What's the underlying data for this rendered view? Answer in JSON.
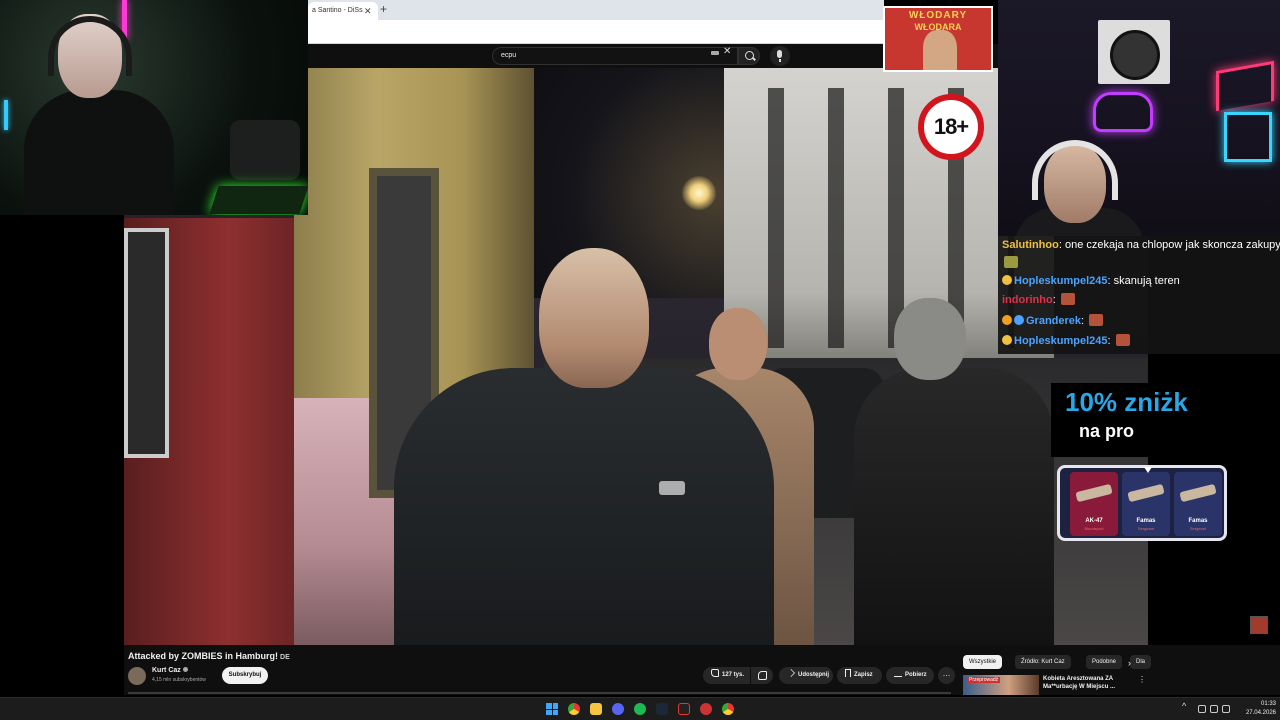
{
  "browser": {
    "tab_title": "a Santino - DiSs",
    "search_query": "ecpu"
  },
  "banner": {
    "line1": "WŁODARY",
    "line2": "WŁODARA"
  },
  "overlay": {
    "age_rating": "18+"
  },
  "chat": {
    "messages": [
      {
        "user": "Salutinhoo",
        "text": "one czekaja na chlopow jak skoncza zakupy",
        "color": "#f0c040"
      },
      {
        "user": "Hopleskumpel245",
        "text": "skanują teren",
        "color": "#4aa3ff"
      },
      {
        "user": "indorinho",
        "text": "",
        "color": "#e0304a"
      },
      {
        "user": "Granderek",
        "text": "",
        "color": "#4aa3ff"
      },
      {
        "user": "Hopleskumpel245",
        "text": "",
        "color": "#4aa3ff"
      }
    ]
  },
  "promo": {
    "headline": "10% zniżk",
    "subline": "na pro",
    "brand_color": "#2aa7e6",
    "cases": [
      {
        "name": "AK-47",
        "sub": "Bloodsport",
        "color": "#8a1a3a"
      },
      {
        "name": "Famas",
        "sub": "Sergeant",
        "color": "#2a3468"
      },
      {
        "name": "Famas",
        "sub": "Sergeant",
        "color": "#2a3468"
      }
    ]
  },
  "video": {
    "title": "Attacked by ZOMBIES in Hamburg!",
    "flag": "DE",
    "channel": "Kurt Caz",
    "subscribers": "4,15 mln subskrybentów",
    "subscribe_label": "Subskrybuj",
    "likes": "127 tys.",
    "share_label": "Udostępnij",
    "save_label": "Zapisz",
    "download_label": "Pobierz"
  },
  "sidebar": {
    "chips": [
      {
        "label": "Wszystkie",
        "active": true
      },
      {
        "label": "Źródło: Kurt Caz",
        "active": false
      },
      {
        "label": "Podobne",
        "active": false
      },
      {
        "label": "Dla",
        "active": false
      }
    ],
    "recommended": {
      "thumb_label": "Przeprowadź",
      "title": "Kobieta Aresztowana ZA Ma**urbację W Miejscu ..."
    }
  },
  "taskbar": {
    "time": "01:33",
    "date": "27.04.2026",
    "accent": "#3ea6ff"
  }
}
